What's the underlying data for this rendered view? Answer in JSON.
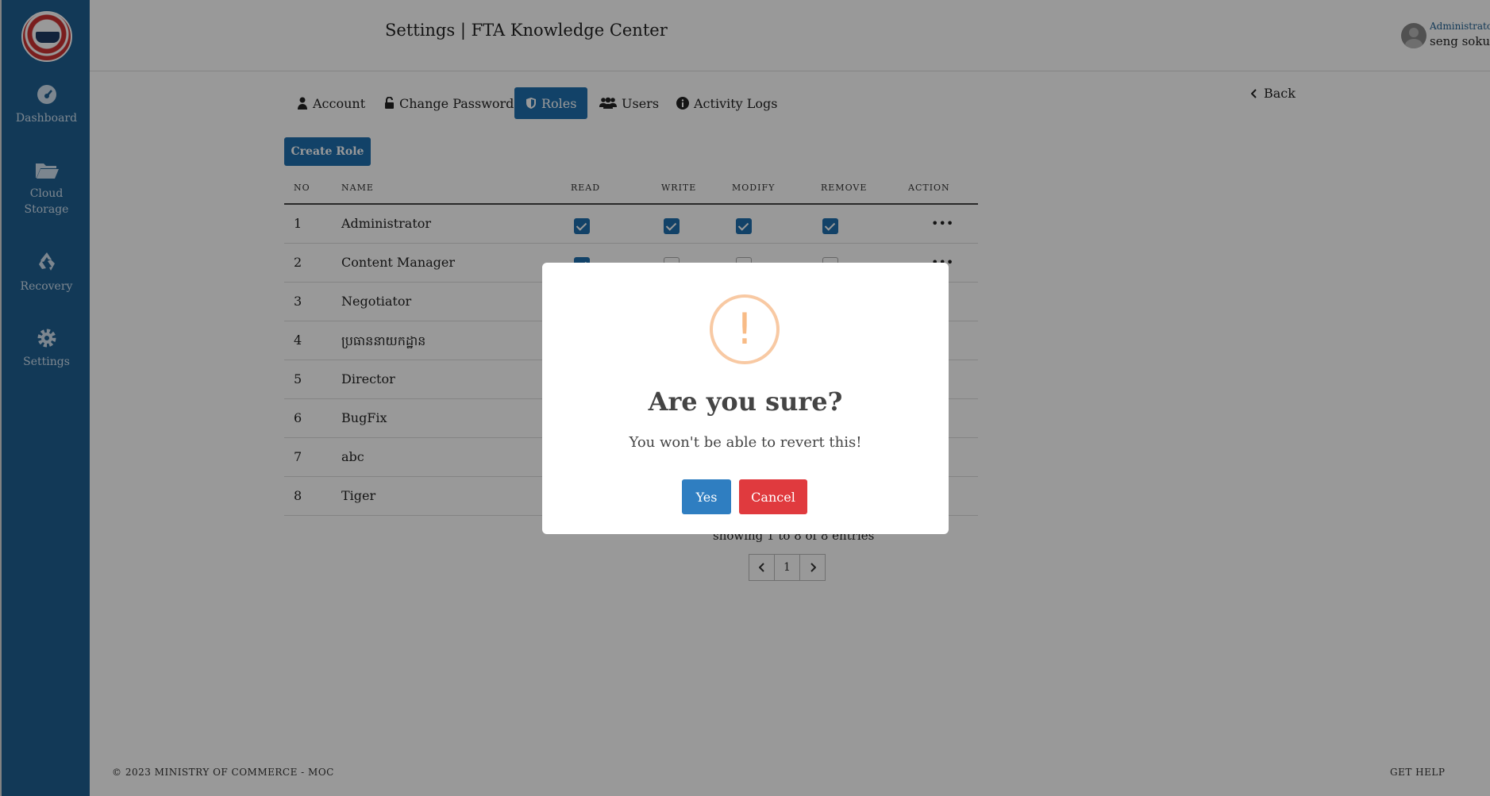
{
  "header": {
    "title": "Settings | FTA Knowledge Center"
  },
  "user": {
    "role": "Administrator",
    "name": "seng sokunthea"
  },
  "sidebar": {
    "items": [
      {
        "label": "Dashboard",
        "icon": "gauge-icon"
      },
      {
        "label": "Cloud Storage",
        "icon": "folder-open-icon"
      },
      {
        "label": "Recovery",
        "icon": "recycle-icon"
      },
      {
        "label": "Settings",
        "icon": "gear-icon"
      }
    ]
  },
  "tabs": [
    {
      "label": "Account",
      "icon": "user-icon"
    },
    {
      "label": "Change Password",
      "icon": "lock-icon"
    },
    {
      "label": "Roles",
      "icon": "shield-icon",
      "active": true
    },
    {
      "label": "Users",
      "icon": "users-icon"
    },
    {
      "label": "Activity Logs",
      "icon": "info-icon"
    }
  ],
  "back_label": "Back",
  "create_role_label": "Create Role",
  "table": {
    "headers": [
      "NO",
      "NAME",
      "READ",
      "WRITE",
      "MODIFY",
      "REMOVE",
      "ACTION"
    ],
    "rows": [
      {
        "no": "1",
        "name": "Administrator",
        "read": true,
        "write": true,
        "modify": true,
        "remove": true
      },
      {
        "no": "2",
        "name": "Content Manager",
        "read": true,
        "write": false,
        "modify": false,
        "remove": false
      },
      {
        "no": "3",
        "name": "Negotiator"
      },
      {
        "no": "4",
        "name": "ប្រធាននាយកដ្ឋាន"
      },
      {
        "no": "5",
        "name": "Director"
      },
      {
        "no": "6",
        "name": "BugFix"
      },
      {
        "no": "7",
        "name": "abc"
      },
      {
        "no": "8",
        "name": "Tiger"
      }
    ]
  },
  "pagination": {
    "summary": "showing 1 to 8 of 8 entries",
    "current_page": "1"
  },
  "footer": {
    "copyright": "© 2023 MINISTRY OF COMMERCE - MOC",
    "help": "GET HELP"
  },
  "modal": {
    "title": "Are you sure?",
    "text": "You won't be able to revert this!",
    "confirm_label": "Yes",
    "cancel_label": "Cancel",
    "icon": "warning-icon",
    "colors": {
      "confirm": "#2f7ec1",
      "cancel": "#e03a3e",
      "warning": "#f8bb86"
    }
  },
  "colors": {
    "sidebar": "#1f5f92",
    "accent": "#1f6fae"
  }
}
